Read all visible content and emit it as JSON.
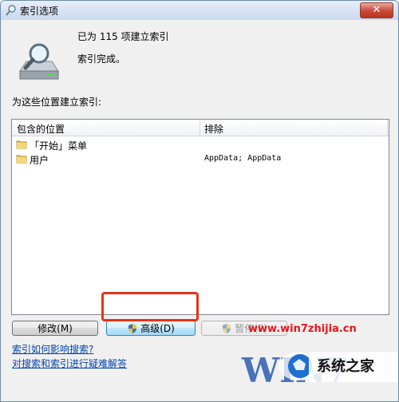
{
  "window": {
    "title": "索引选项",
    "close_glyph": "✕"
  },
  "status": {
    "count_line": "已为 115 项建立索引",
    "state_line": "索引完成。"
  },
  "locations": {
    "label": "为这些位置建立索引:",
    "columns": {
      "included": "包含的位置",
      "excluded": "排除"
    },
    "rows": [
      {
        "name": "「开始」菜单",
        "exclude": ""
      },
      {
        "name": "用户",
        "exclude": "AppData; AppData"
      }
    ]
  },
  "buttons": {
    "modify": "修改(M)",
    "advanced": "高级(D)",
    "pause": "暂停(P)"
  },
  "links": {
    "how_affects": "索引如何影响搜索?",
    "troubleshoot": "对搜索和索引进行疑难解答"
  },
  "watermark": {
    "url": "www.win7zhijia.cn",
    "logo_text": "WIN7",
    "site_name": "系统之家"
  },
  "colors": {
    "highlight": "#e53319",
    "link": "#0645ad",
    "watermark_url": "#e8141b"
  }
}
